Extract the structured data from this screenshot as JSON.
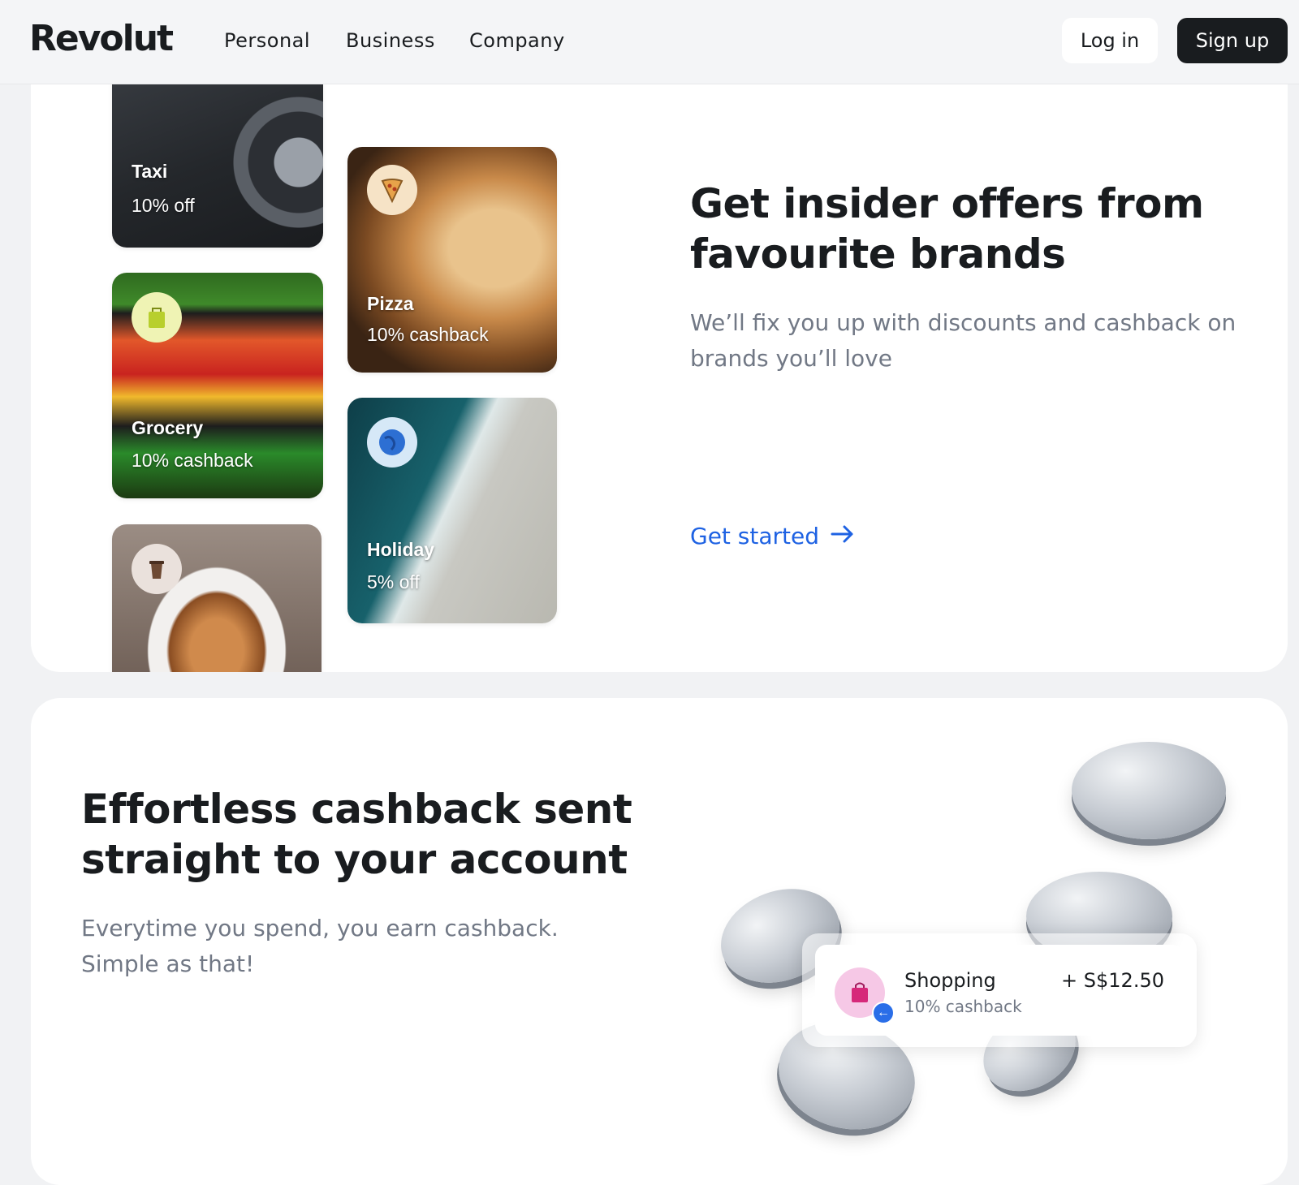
{
  "nav": {
    "logo": "Revolut",
    "links": [
      "Personal",
      "Business",
      "Company"
    ],
    "login_label": "Log in",
    "signup_label": "Sign up"
  },
  "offers_section": {
    "heading": "Get insider offers from favourite brands",
    "subheading": "We’ll fix you up with discounts and cashback on brands you’ll love",
    "cta_label": "Get started",
    "tiles": [
      {
        "name": "Taxi",
        "offer": "10% off",
        "icon": "taxi-image"
      },
      {
        "name": "Pizza",
        "offer": "10% cashback",
        "icon": "pizza-icon"
      },
      {
        "name": "Grocery",
        "offer": "10% cashback",
        "icon": "shopping-bag-icon"
      },
      {
        "name": "Holiday",
        "offer": "5% off",
        "icon": "globe-icon"
      },
      {
        "name": "",
        "offer": "",
        "icon": "coffee-cup-icon"
      }
    ],
    "accent_color": "#1e62e3"
  },
  "cashback_section": {
    "heading": "Effortless cashback sent straight to your account",
    "subheading": "Everytime you spend, you earn cashback. Simple as that!",
    "transaction": {
      "title": "Shopping",
      "subtitle": "10% cashback",
      "amount": "+ S$12.50",
      "icon": "shopping-bag-icon",
      "badge_icon": "arrow-left-icon"
    }
  }
}
